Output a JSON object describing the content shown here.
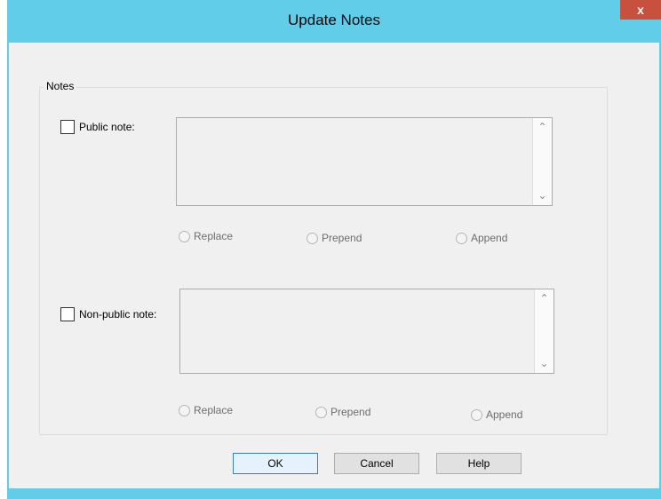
{
  "window": {
    "title": "Update Notes",
    "close_label": "x"
  },
  "notes_group": {
    "label": "Notes",
    "public": {
      "checkbox_label": "Public note:",
      "checked": false,
      "value": "",
      "options": [
        "Replace",
        "Prepend",
        "Append"
      ]
    },
    "nonpublic": {
      "checkbox_label": "Non-public note:",
      "checked": false,
      "value": "",
      "options": [
        "Replace",
        "Prepend",
        "Append"
      ]
    }
  },
  "buttons": {
    "ok": "OK",
    "cancel": "Cancel",
    "help": "Help"
  },
  "icons": {
    "scroll_up": "▲-caret-icon",
    "scroll_down": "▼-caret-icon"
  }
}
